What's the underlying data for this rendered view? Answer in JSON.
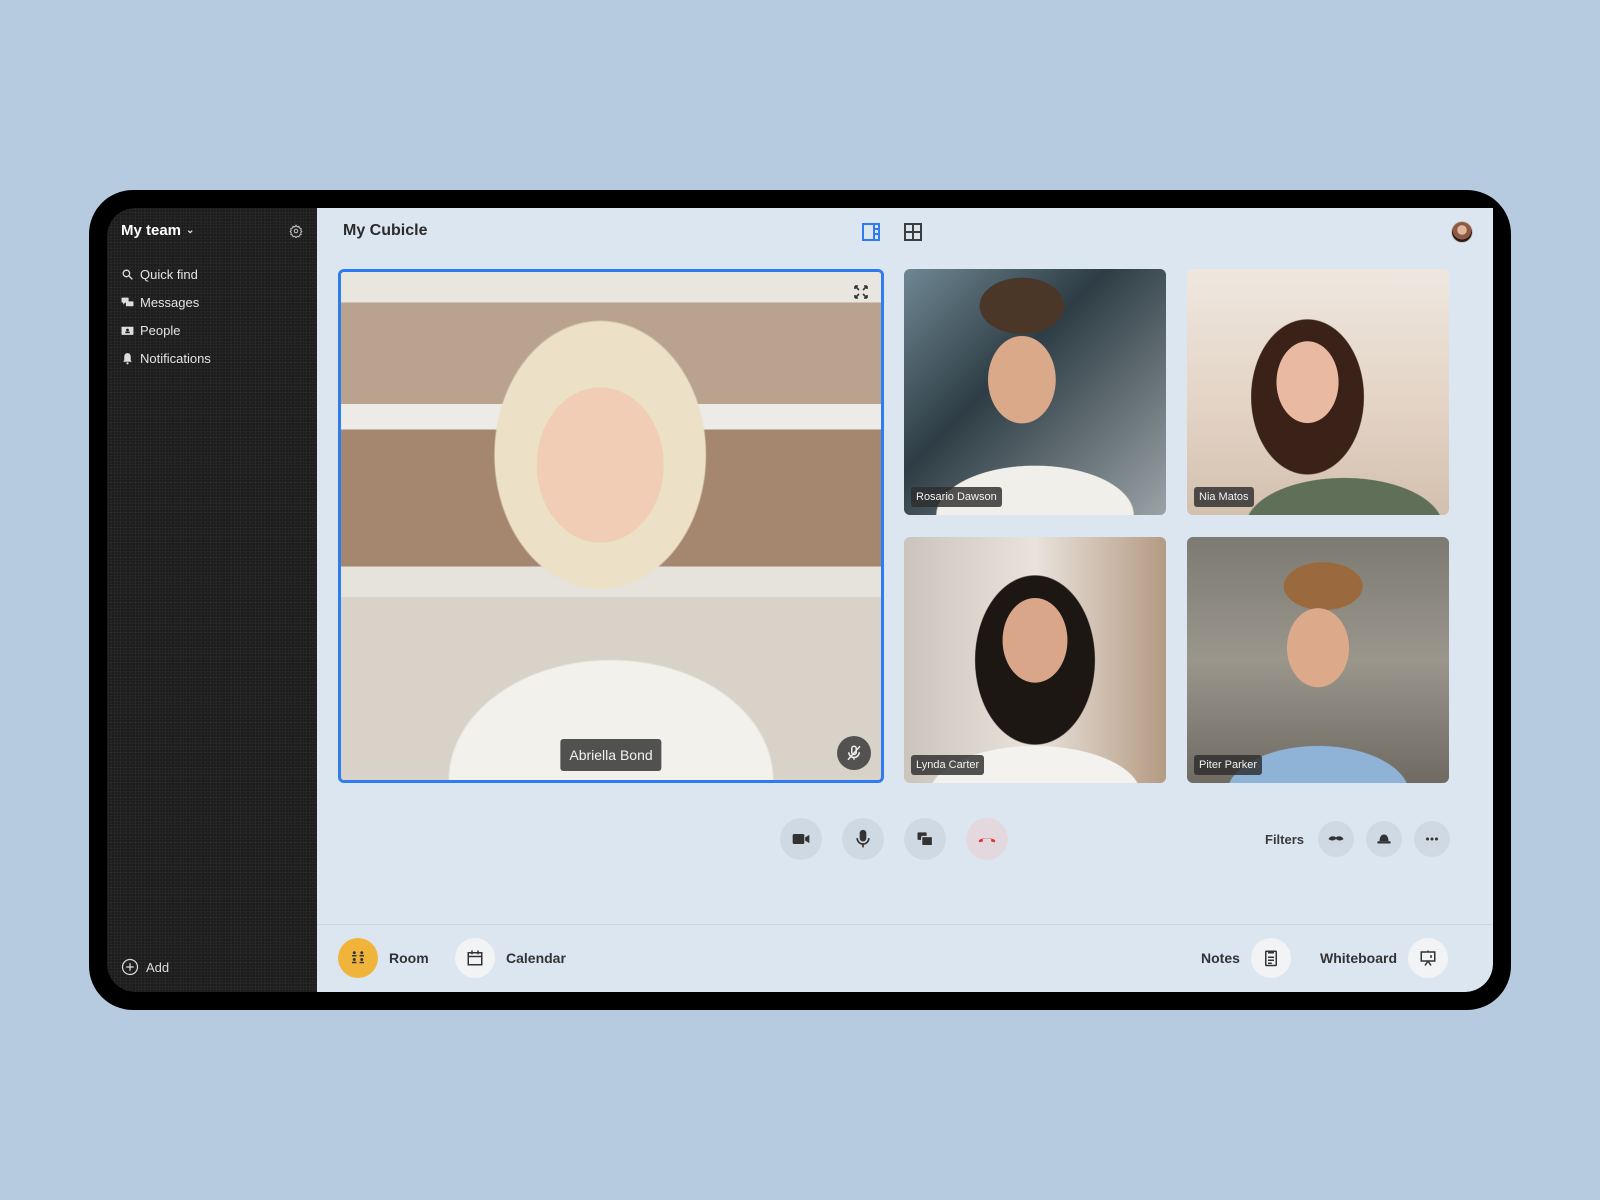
{
  "sidebar": {
    "team_name": "My team",
    "nav": [
      {
        "label": "Quick find",
        "icon": "search-icon"
      },
      {
        "label": "Messages",
        "icon": "chat-icon"
      },
      {
        "label": "People",
        "icon": "people-card-icon"
      },
      {
        "label": "Notifications",
        "icon": "bell-icon"
      }
    ],
    "add_label": "Add"
  },
  "header": {
    "title": "My Cubicle",
    "active_view": "sidebar-view",
    "accent_color": "#2f7cf0"
  },
  "participants": {
    "featured": {
      "name": "Abriella Bond",
      "muted": true
    },
    "grid": [
      {
        "name": "Rosario Dawson"
      },
      {
        "name": "Nia Matos"
      },
      {
        "name": "Lynda Carter"
      },
      {
        "name": "Piter Parker"
      }
    ]
  },
  "controls": {
    "buttons": [
      "camera",
      "microphone",
      "screen-share",
      "end-call"
    ],
    "end_call_color": "#e8302a",
    "filters_label": "Filters",
    "filters": [
      "mustache",
      "hat",
      "more"
    ]
  },
  "bottom_bar": {
    "room_label": "Room",
    "calendar_label": "Calendar",
    "notes_label": "Notes",
    "whiteboard_label": "Whiteboard",
    "room_color": "#f1b43a"
  }
}
